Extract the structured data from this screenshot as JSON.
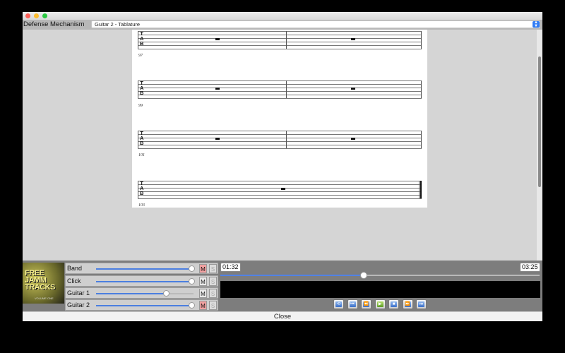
{
  "header": {
    "song_title": "Defense Mechanism",
    "track_select_value": "Guitar 2 - Tablature"
  },
  "score": {
    "tab_letters": [
      "T",
      "A",
      "B"
    ],
    "measure_numbers": [
      "97",
      "99",
      "101",
      "103"
    ]
  },
  "mixer": {
    "album_art_text": [
      "FREE",
      "JAMM",
      "TRACKS"
    ],
    "album_art_subtext": "VOLUME ONE",
    "tracks": [
      {
        "name": "Band",
        "mute_label": "M",
        "solo_label": "S",
        "muted": true,
        "volume_fraction": 0.98
      },
      {
        "name": "Click",
        "mute_label": "M",
        "solo_label": "S",
        "muted": false,
        "volume_fraction": 0.98
      },
      {
        "name": "Guitar 1",
        "mute_label": "M",
        "solo_label": "S",
        "muted": false,
        "volume_fraction": 0.72
      },
      {
        "name": "Guitar 2",
        "mute_label": "M",
        "solo_label": "S",
        "muted": true,
        "volume_fraction": 0.98
      }
    ]
  },
  "transport": {
    "current_time": "01:32",
    "total_time": "03:25",
    "position_fraction": 0.45,
    "buttons": [
      {
        "name": "loop-button",
        "icon": "loop-icon",
        "glyph": "⟲"
      },
      {
        "name": "go-to-start-button",
        "icon": "skip-start-icon",
        "glyph": "⏮"
      },
      {
        "name": "rewind-button",
        "icon": "rewind-icon",
        "glyph": "⏪"
      },
      {
        "name": "play-button",
        "icon": "play-icon",
        "glyph": "▶",
        "active": true
      },
      {
        "name": "stop-button",
        "icon": "stop-icon",
        "glyph": "■"
      },
      {
        "name": "fast-forward-button",
        "icon": "fast-forward-icon",
        "glyph": "⏩"
      },
      {
        "name": "go-to-end-button",
        "icon": "skip-end-icon",
        "glyph": "⏭"
      }
    ]
  },
  "footer": {
    "close_label": "Close"
  },
  "colors": {
    "mute_on": "#f0a0a0",
    "slider_fill": "#4b7fe0",
    "scrollbar_accent": "#2f7bf5"
  }
}
